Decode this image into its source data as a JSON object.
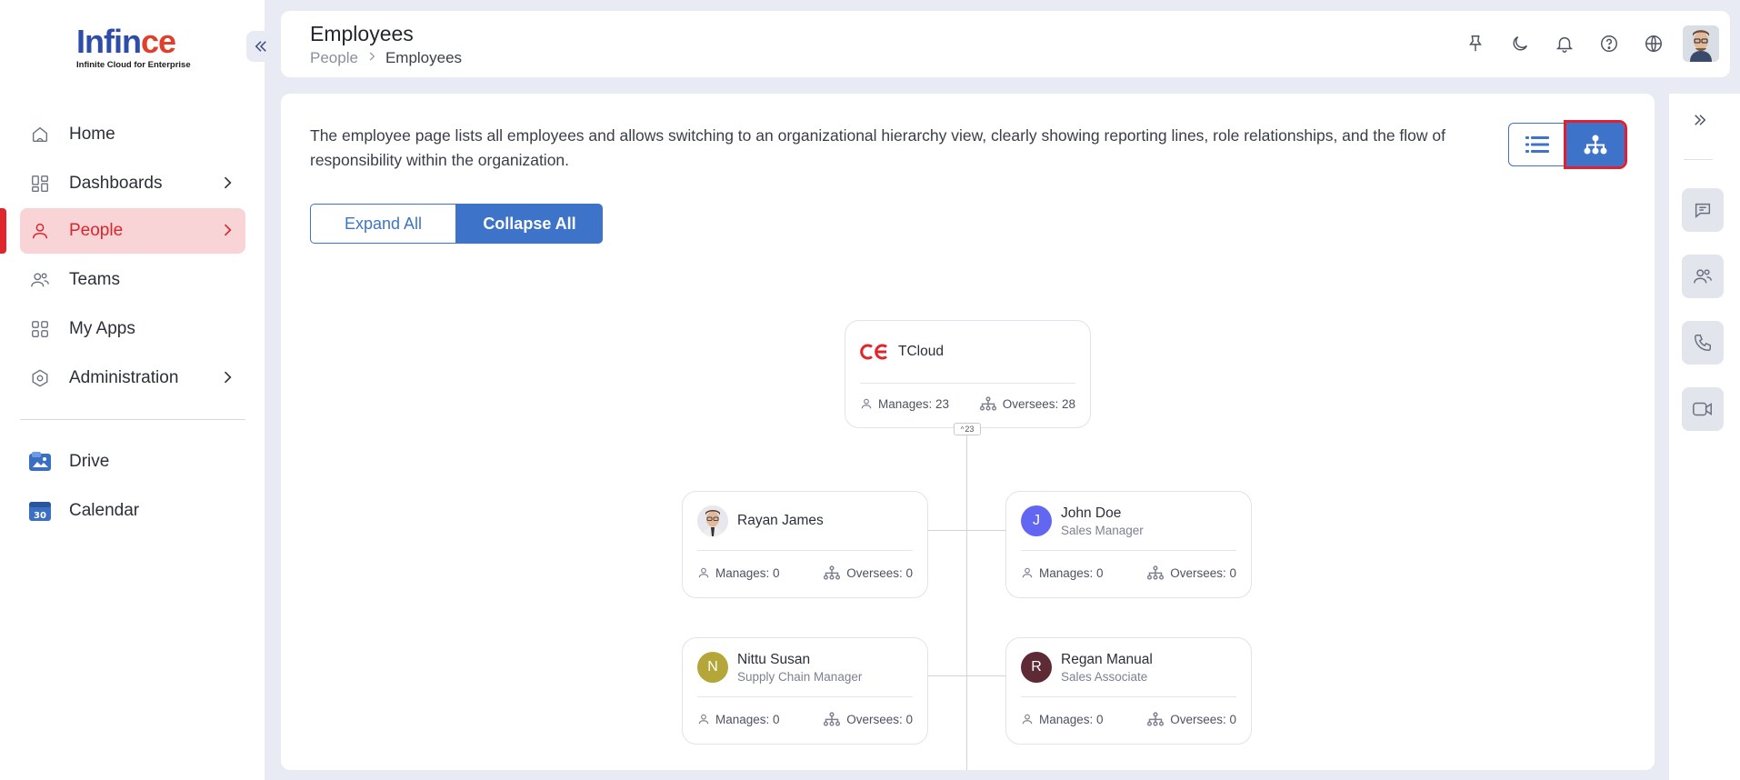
{
  "brand": {
    "logo_text_main": "Inf",
    "logo_text_mid": "in",
    "logo_text_accent": "ce",
    "tagline": "Infinite Cloud for Enterprise"
  },
  "sidebar": {
    "items": [
      {
        "label": "Home",
        "icon": "home-icon",
        "has_chevron": false,
        "active": false
      },
      {
        "label": "Dashboards",
        "icon": "dashboard-icon",
        "has_chevron": true,
        "active": false
      },
      {
        "label": "People",
        "icon": "user-icon",
        "has_chevron": true,
        "active": true
      },
      {
        "label": "Teams",
        "icon": "team-icon",
        "has_chevron": false,
        "active": false
      },
      {
        "label": "My Apps",
        "icon": "apps-icon",
        "has_chevron": false,
        "active": false
      },
      {
        "label": "Administration",
        "icon": "settings-icon",
        "has_chevron": true,
        "active": false
      }
    ],
    "apps": [
      {
        "label": "Drive",
        "icon": "drive-icon"
      },
      {
        "label": "Calendar",
        "icon": "calendar-icon",
        "badge": "30"
      }
    ]
  },
  "header": {
    "title": "Employees",
    "breadcrumb": {
      "parent": "People",
      "current": "Employees"
    },
    "icons": [
      "pin-icon",
      "moon-icon",
      "bell-icon",
      "help-icon",
      "globe-icon"
    ]
  },
  "main": {
    "description": "The employee page lists all employees and allows switching to an organizational hierarchy view, clearly showing reporting lines, role relationships, and the flow of responsibility within the organization.",
    "expand_label": "Expand All",
    "collapse_label": "Collapse All",
    "view_modes": [
      "list",
      "hierarchy"
    ],
    "active_view": "hierarchy"
  },
  "org": {
    "root": {
      "name": "TCloud",
      "manages": "Manages: 23",
      "oversees": "Oversees: 28",
      "child_count": "23"
    },
    "children": [
      {
        "name": "Rayan James",
        "role": "",
        "initial": "",
        "avatar_color": "",
        "manages": "Manages: 0",
        "oversees": "Oversees: 0",
        "has_photo": true
      },
      {
        "name": "John Doe",
        "role": "Sales Manager",
        "initial": "J",
        "avatar_color": "#6366f1",
        "manages": "Manages: 0",
        "oversees": "Oversees: 0",
        "has_photo": false
      },
      {
        "name": "Nittu Susan",
        "role": "Supply Chain Manager",
        "initial": "N",
        "avatar_color": "#b5a63a",
        "manages": "Manages: 0",
        "oversees": "Oversees: 0",
        "has_photo": false
      },
      {
        "name": "Regan Manual",
        "role": "Sales Associate",
        "initial": "R",
        "avatar_color": "#5e2a36",
        "manages": "Manages: 0",
        "oversees": "Oversees: 0",
        "has_photo": false
      }
    ]
  },
  "rail": {
    "icons": [
      "chat-icon",
      "contacts-icon",
      "phone-icon",
      "video-icon"
    ]
  },
  "colors": {
    "primary": "#3d74c9",
    "active_red": "#e0262d",
    "active_bg": "#f9d4d6",
    "page_bg": "#e8ebf4"
  }
}
